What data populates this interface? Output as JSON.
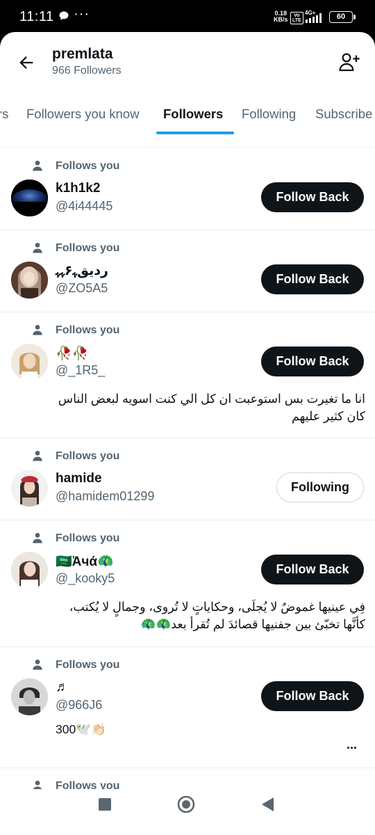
{
  "status_bar": {
    "time": "11:11",
    "net_speed_value": "0.18",
    "net_speed_unit": "KB/s",
    "volte_top": "Vo",
    "volte_bottom": "LTE",
    "network": "4G+",
    "battery": "60"
  },
  "header": {
    "title": "premlata",
    "subtitle": "966 Followers"
  },
  "tabs": [
    {
      "label": "rs",
      "active": false
    },
    {
      "label": "Followers you know",
      "active": false
    },
    {
      "label": "Followers",
      "active": true
    },
    {
      "label": "Following",
      "active": false
    },
    {
      "label": "Subscribe",
      "active": false
    }
  ],
  "colors": {
    "accent": "#1d9bf0",
    "text_primary": "#0f1419",
    "text_secondary": "#536471",
    "button_dark": "#0f1419"
  },
  "followers": [
    {
      "follows_label": "Follows you",
      "name": "k1h1k2",
      "handle": "@4i44445",
      "button": "Follow Back",
      "bio": ""
    },
    {
      "follows_label": "Follows you",
      "name": "ردیقﮩ۶ﮩﮩ",
      "handle": "@ZO5A5",
      "button": "Follow Back",
      "bio": ""
    },
    {
      "follows_label": "Follows you",
      "name": "🥀🥀",
      "handle": "@_1R5_",
      "button": "Follow Back",
      "bio": "انا ما تغيرت بس استوعبت ان كل الي كنت اسويه لبعض الناس كان كثير عليهم"
    },
    {
      "follows_label": "Follows you",
      "name": "hamide",
      "handle": "@hamidem01299",
      "button": "Following",
      "bio": ""
    },
    {
      "follows_label": "Follows you",
      "name": "🇸🇦Ἀчά🦚",
      "handle": "@_kooky5",
      "button": "Follow Back",
      "bio": "فِي عينيها غموضٌ لا يُجلَى، وحكاياتٍ لا تُروى، وجمالٍ لا يُكتب، كأنَّها تخبّئ بين جفنيها قصائدَ لم تُقرأ بعد🦚🦚"
    },
    {
      "follows_label": "Follows you",
      "name": "♬",
      "handle": "@966J6",
      "button": "Follow Back",
      "bio": "300🕊️👏🏻",
      "more": "..."
    },
    {
      "follows_label": "Follows you",
      "name": "",
      "handle": "",
      "button": "",
      "bio": ""
    }
  ],
  "icons": {
    "back": "arrow-left-icon",
    "add_user": "add-user-icon",
    "person": "person-icon",
    "nav_recents": "square-icon",
    "nav_home": "circle-icon",
    "nav_back": "triangle-back-icon"
  }
}
